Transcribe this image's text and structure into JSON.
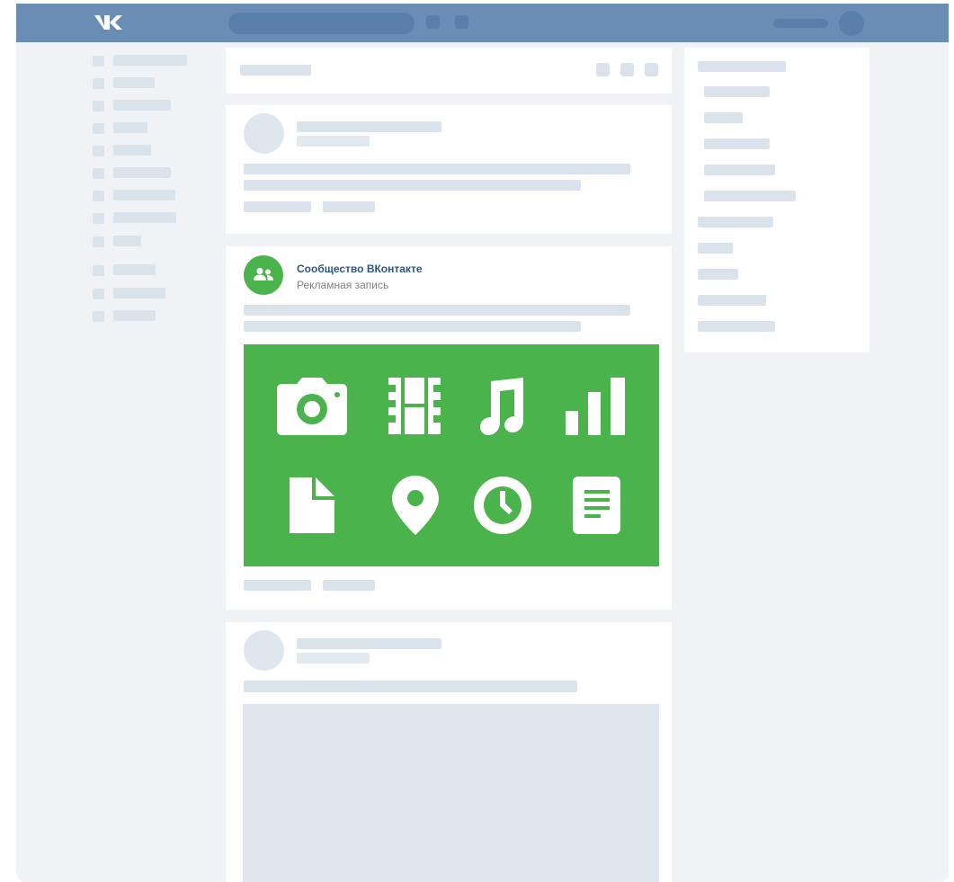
{
  "ad_post": {
    "community_name": "Сообщество ВКонтакте",
    "label": "Рекламная запись",
    "media_icons": [
      "camera-icon",
      "film-icon",
      "music-note-icon",
      "bar-chart-icon",
      "document-icon",
      "location-pin-icon",
      "clock-icon",
      "article-icon"
    ]
  },
  "colors": {
    "topbar": "#6a8db5",
    "topbar_placeholder": "#587ea9",
    "page_background": "#f0f2f5",
    "skeleton": "#dae2ec",
    "ad_media_background": "#4bb34b",
    "community_name_link": "#2a5885"
  },
  "icons": {
    "logo": "vk-logo-icon",
    "community_avatar": "community-users-icon"
  }
}
